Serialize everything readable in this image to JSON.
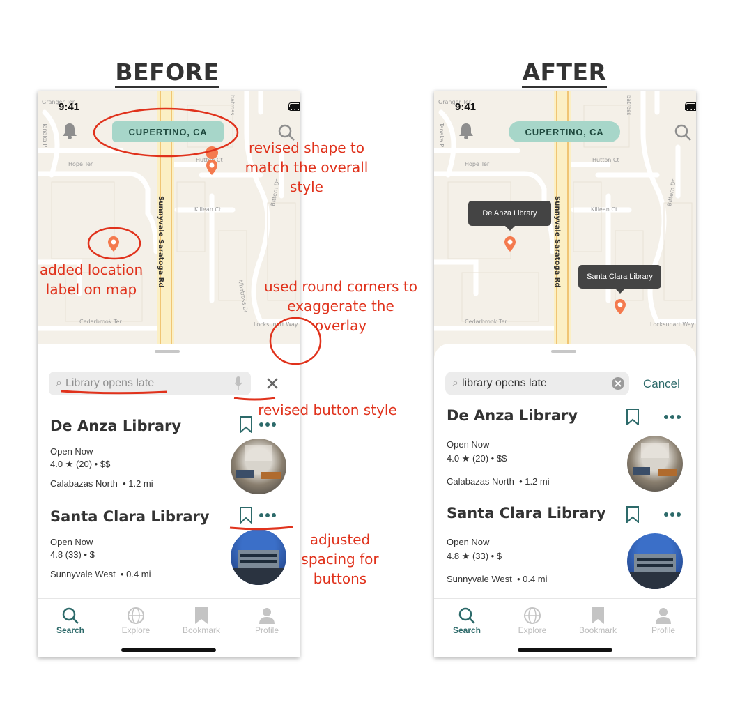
{
  "headings": {
    "before": "BEFORE",
    "after": "AFTER"
  },
  "status": {
    "time": "9:41"
  },
  "location": "CUPERTINO, CA",
  "map_streets": {
    "granger": "Granger Ter",
    "tanaka": "Tanaka Pl",
    "hope": "Hope Ter",
    "hutton": "Hutton Ct",
    "killean": "Killean Ct",
    "saratoga": "Sunnyvale Saratoga Rd",
    "bittern": "Bittern Dr",
    "albatross": "Albatross Dr",
    "cedarbrook": "Cedarbrook Ter",
    "locksunart": "Locksunart Way",
    "batross": "batross"
  },
  "before": {
    "search_text": "Library opens late",
    "annotations": {
      "shape": "revised shape to match the overall style",
      "label": "added location label on map",
      "corners": "used round corners to exaggerate the overlay",
      "button": "revised button style",
      "spacing": "adjusted spacing for buttons"
    }
  },
  "after": {
    "search_text": "library opens late",
    "cancel_label": "Cancel",
    "map_labels": [
      "De Anza Library",
      "Santa Clara Library"
    ]
  },
  "results": [
    {
      "title": "De Anza Library",
      "status": "Open Now",
      "rating": "4.0 ★ (20) • $$",
      "area": "Calabazas North",
      "distance": "• 1.2 mi"
    },
    {
      "title": "Santa Clara Library",
      "status": "Open Now",
      "rating_before": "4.8 (33) • $",
      "rating": "4.8 ★ (33) • $",
      "area": "Sunnyvale West",
      "distance": "• 0.4 mi"
    }
  ],
  "tabs": [
    "Search",
    "Explore",
    "Bookmark",
    "Profile"
  ],
  "colors": {
    "accent": "#2d6a6a",
    "pill": "#a7d6c9",
    "pin": "#f47a4e",
    "annotation": "#e0321c"
  }
}
